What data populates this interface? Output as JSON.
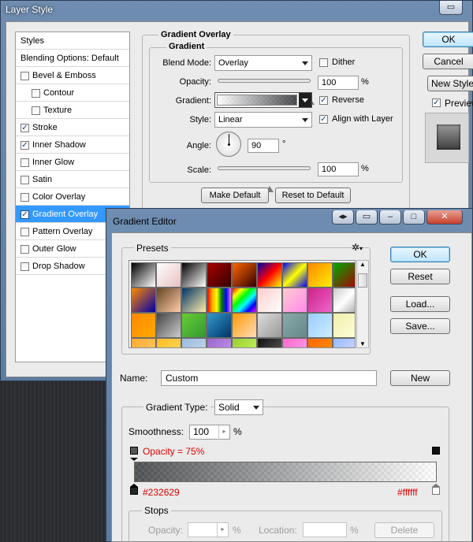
{
  "layer_style": {
    "title": "Layer Style",
    "styles_header": "Styles",
    "blending_options": "Blending Options: Default",
    "items": [
      {
        "label": "Bevel & Emboss",
        "checked": false,
        "sub": false
      },
      {
        "label": "Contour",
        "checked": false,
        "sub": true
      },
      {
        "label": "Texture",
        "checked": false,
        "sub": true
      },
      {
        "label": "Stroke",
        "checked": true,
        "sub": false
      },
      {
        "label": "Inner Shadow",
        "checked": true,
        "sub": false
      },
      {
        "label": "Inner Glow",
        "checked": false,
        "sub": false
      },
      {
        "label": "Satin",
        "checked": false,
        "sub": false
      },
      {
        "label": "Color Overlay",
        "checked": false,
        "sub": false
      },
      {
        "label": "Gradient Overlay",
        "checked": true,
        "sub": false,
        "active": true
      },
      {
        "label": "Pattern Overlay",
        "checked": false,
        "sub": false
      },
      {
        "label": "Outer Glow",
        "checked": false,
        "sub": false
      },
      {
        "label": "Drop Shadow",
        "checked": false,
        "sub": false
      }
    ],
    "panel": {
      "section_title": "Gradient Overlay",
      "group_title": "Gradient",
      "blend_mode_label": "Blend Mode:",
      "blend_mode_value": "Overlay",
      "dither_label": "Dither",
      "dither_checked": false,
      "opacity_label": "Opacity:",
      "opacity_value": "100",
      "opacity_unit": "%",
      "opacity_fraction": 1.0,
      "gradient_label": "Gradient:",
      "reverse_label": "Reverse",
      "reverse_checked": true,
      "style_label": "Style:",
      "style_value": "Linear",
      "align_label": "Align with Layer",
      "align_checked": true,
      "angle_label": "Angle:",
      "angle_value": "90",
      "angle_unit": "°",
      "scale_label": "Scale:",
      "scale_value": "100",
      "scale_unit": "%",
      "scale_fraction": 0.5,
      "make_default": "Make Default",
      "reset_default": "Reset to Default"
    },
    "buttons": {
      "ok": "OK",
      "cancel": "Cancel",
      "new_style": "New Style...",
      "preview_label": "Preview",
      "preview_checked": true
    }
  },
  "gradient_editor": {
    "title": "Gradient Editor",
    "presets_label": "Presets",
    "buttons": {
      "ok": "OK",
      "reset": "Reset",
      "load": "Load...",
      "save": "Save...",
      "new": "New"
    },
    "name_label": "Name:",
    "name_value": "Custom",
    "gradient_type_label": "Gradient Type:",
    "gradient_type_value": "Solid",
    "smoothness_label": "Smoothness:",
    "smoothness_value": "100",
    "smoothness_unit": "%",
    "opacity_readout": "Opacity = 75%",
    "color_left": "#232629",
    "color_right": "#ffffff",
    "stops": {
      "label": "Stops",
      "opacity_label": "Opacity:",
      "opacity_unit": "%",
      "location_label": "Location:",
      "location_unit": "%",
      "delete": "Delete"
    }
  },
  "colors": {
    "accent_blue": "#3399ff",
    "stop_red": "#e00000",
    "gradient_start": "#232629",
    "gradient_end": "#ffffff"
  }
}
